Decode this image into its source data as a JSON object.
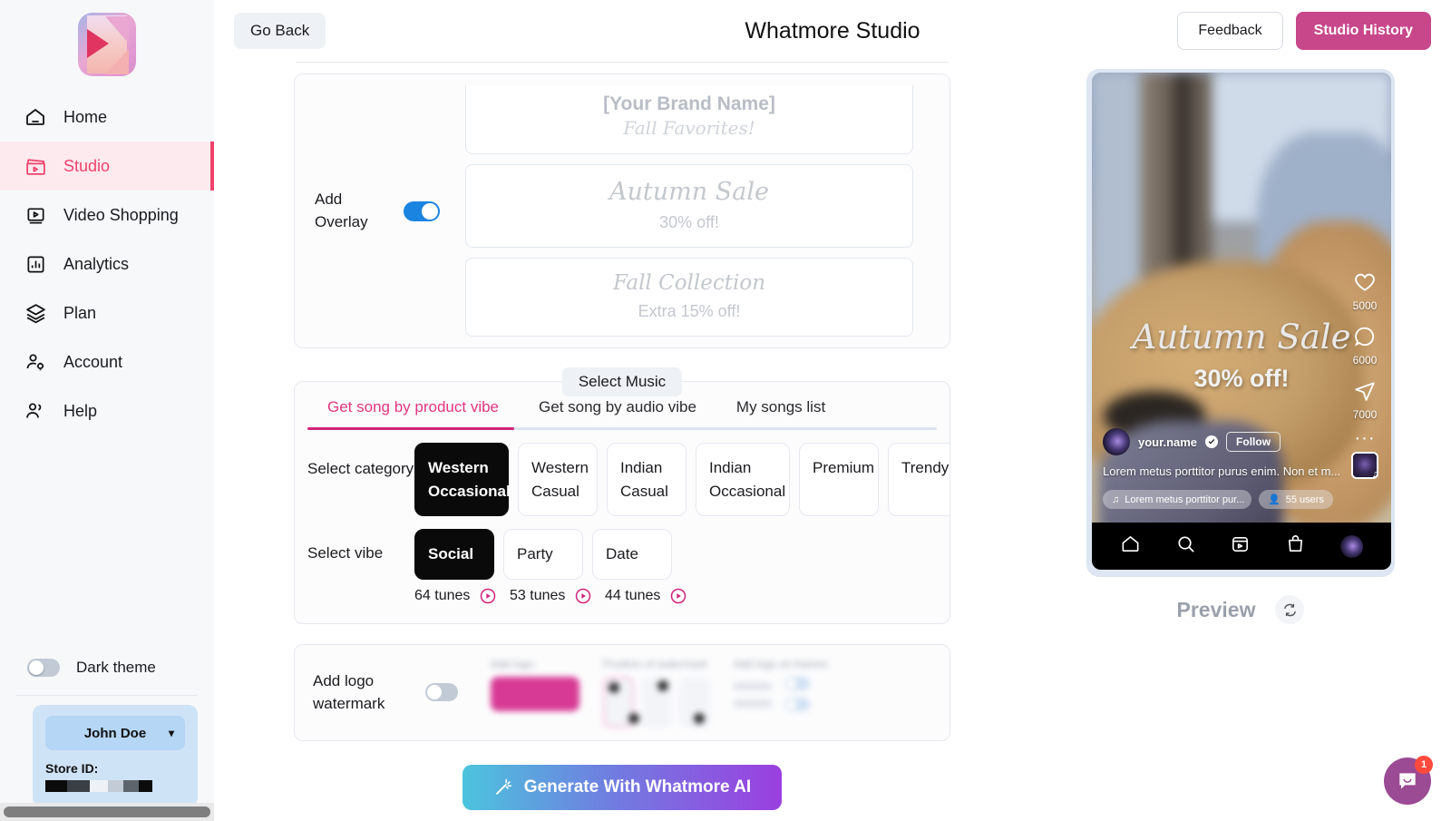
{
  "sidebar": {
    "logo_name": "whatmore-logo",
    "items": [
      {
        "label": "Home",
        "icon": "home-icon"
      },
      {
        "label": "Studio",
        "icon": "clapperboard-icon"
      },
      {
        "label": "Video Shopping",
        "icon": "video-icon"
      },
      {
        "label": "Analytics",
        "icon": "bar-chart-icon"
      },
      {
        "label": "Plan",
        "icon": "layers-icon"
      },
      {
        "label": "Account",
        "icon": "user-gear-icon"
      },
      {
        "label": "Help",
        "icon": "users-icon"
      }
    ],
    "theme_toggle_label": "Dark theme",
    "store": {
      "user_name": "John Doe",
      "store_id_label": "Store ID:",
      "store_id_value": "██████"
    }
  },
  "topbar": {
    "go_back_label": "Go Back",
    "title": "Whatmore Studio",
    "feedback_label": "Feedback",
    "history_label": "Studio History"
  },
  "overlay": {
    "label": "Add\nOverlay",
    "enabled": true,
    "cards": [
      {
        "title": "[Your Brand Name]",
        "subtitle": "Fall Favorites!"
      },
      {
        "title": "Autumn Sale",
        "subtitle": "30% off!"
      },
      {
        "title": "Fall Collection",
        "subtitle": "Extra 15% off!"
      }
    ]
  },
  "music": {
    "chip_label": "Select Music",
    "tabs": [
      {
        "label": "Get song by product vibe",
        "active": true
      },
      {
        "label": "Get song by audio vibe",
        "active": false
      },
      {
        "label": "My songs list",
        "active": false
      }
    ],
    "category_label": "Select\ncategory",
    "categories": [
      {
        "label": "Western\nOccasional",
        "selected": true
      },
      {
        "label": "Western\nCasual",
        "selected": false
      },
      {
        "label": "Indian\nCasual",
        "selected": false
      },
      {
        "label": "Indian\nOccasional",
        "selected": false
      },
      {
        "label": "Premium",
        "selected": false
      },
      {
        "label": "Trendy",
        "selected": false
      }
    ],
    "vibe_label": "Select vibe",
    "vibes": [
      {
        "label": "Social",
        "selected": true,
        "tunes": "64 tunes"
      },
      {
        "label": "Party",
        "selected": false,
        "tunes": "53 tunes"
      },
      {
        "label": "Date",
        "selected": false,
        "tunes": "44 tunes"
      }
    ]
  },
  "watermark": {
    "label": "Add logo\nwatermark",
    "enabled": false,
    "add_logo_caption": "Add logo",
    "upload_label": "Upload",
    "position_caption": "Position of watermark",
    "frames_caption": "Add logo on frames",
    "frame_options": [
      "Intro",
      "Outro"
    ]
  },
  "generate": {
    "label": "Generate With Whatmore AI",
    "icon": "magic-wand-icon"
  },
  "preview": {
    "overlay_title": "Autumn Sale",
    "overlay_subtitle": "30% off!",
    "actions": [
      {
        "icon": "heart-icon",
        "count": "5000"
      },
      {
        "icon": "comment-icon",
        "count": "6000"
      },
      {
        "icon": "share-icon",
        "count": "7000"
      }
    ],
    "more_icon": "more-dots-icon",
    "username": "your.name",
    "follow_label": "Follow",
    "caption": "Lorem metus porttitor purus enim. Non et m...",
    "music_chip": "Lorem metus porttitor pur...",
    "users_chip": "55 users",
    "nav_icons": [
      "home-icon",
      "search-icon",
      "reels-icon",
      "shop-icon",
      "profile-avatar"
    ],
    "label": "Preview",
    "refresh_icon": "refresh-icon"
  },
  "chat": {
    "icon": "chat-bubble-icon",
    "badge": "1"
  },
  "colors": {
    "accent_pink": "#e0367f",
    "studio_pink": "#f0426b",
    "history_magenta": "#c8468a",
    "toggle_blue": "#1b84e0",
    "arrow_orange": "#f4451b",
    "chat_purple": "#9b4a94"
  }
}
